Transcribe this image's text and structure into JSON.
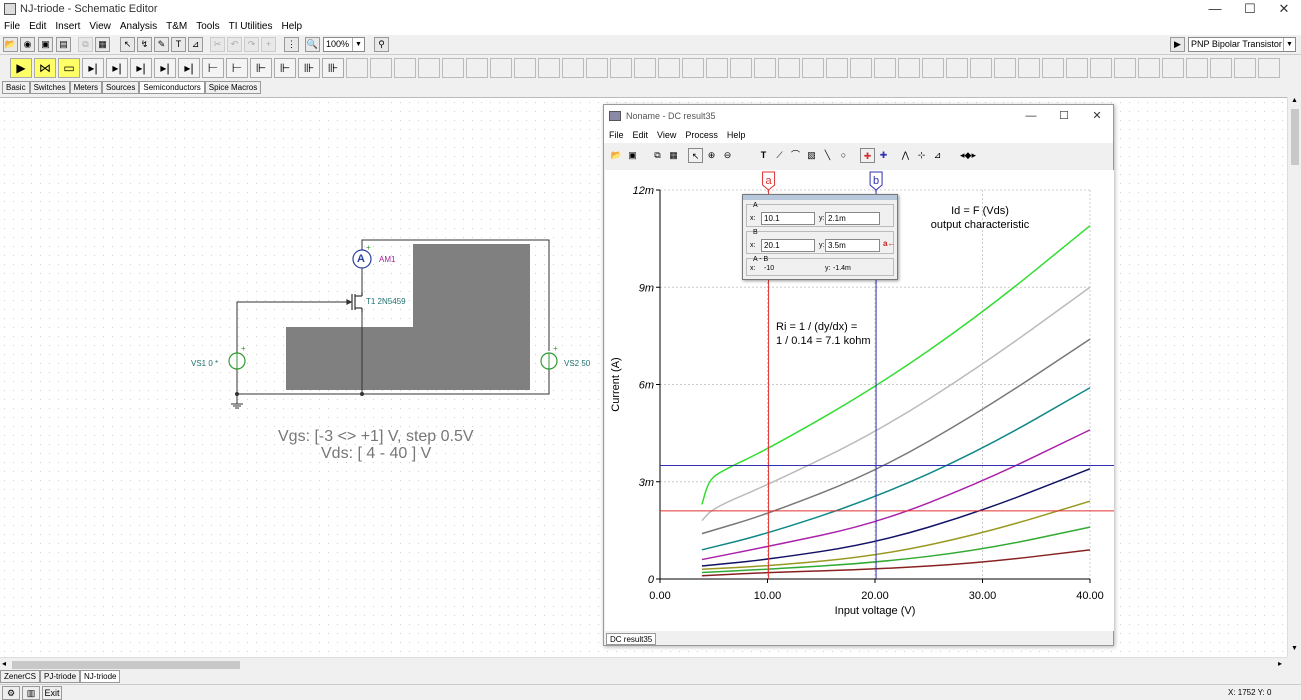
{
  "app": {
    "title": "NJ-triode - Schematic Editor",
    "window_controls": [
      "—",
      "☐",
      "✕"
    ]
  },
  "menu": [
    "File",
    "Edit",
    "Insert",
    "View",
    "Analysis",
    "T&M",
    "Tools",
    "TI Utilities",
    "Help"
  ],
  "toolbar": {
    "zoom_value": "100%",
    "component_select": "PNP Bipolar Transistor"
  },
  "component_tabs": [
    "Basic",
    "Switches",
    "Meters",
    "Sources",
    "Semiconductors",
    "Spice Macros"
  ],
  "component_tabs_selected": 4,
  "schematic": {
    "ammeter_label": "AM1",
    "ammeter_symbol": "A",
    "transistor_label": "T1 2N5459",
    "source1_label": "VS1 0 *",
    "source2_label": "VS2 50",
    "plus_sign": "+",
    "caption_line1": "Vgs: [-3 <> +1] V, step 0.5V",
    "caption_line2": "Vds: [ 4 - 40 ] V",
    "colors": {
      "wire": "#333333",
      "source": "#2e9a2e",
      "ammeter": "#2b3fa0",
      "grey_block": "#808080"
    }
  },
  "result_window": {
    "title": "Noname - DC result35",
    "menu": [
      "File",
      "Edit",
      "View",
      "Process",
      "Help"
    ],
    "tab": "DC result35"
  },
  "cursor_panel": {
    "group_a": "A",
    "group_b": "B",
    "group_diff": "A - B",
    "x_label": "x:",
    "y_label": "y:",
    "a_x": "10.1",
    "a_y": "2.1m",
    "b_x": "20.1",
    "b_y": "3.5m",
    "diff_x": "-10",
    "diff_y": "-1.4m",
    "marker_button": "a←"
  },
  "chart_data": {
    "type": "line",
    "title": "Id = F (Vds)",
    "subtitle": "output characteristic",
    "xlabel": "Input voltage (V)",
    "ylabel": "Current (A)",
    "xlim": [
      0,
      40
    ],
    "ylim": [
      0,
      0.012
    ],
    "x_ticks": [
      0,
      10,
      20,
      30,
      40
    ],
    "x_tick_labels": [
      "0.00",
      "10.00",
      "20.00",
      "30.00",
      "40.00"
    ],
    "y_ticks": [
      0,
      0.003,
      0.006,
      0.009,
      0.012
    ],
    "y_tick_labels": [
      "0",
      "3m",
      "6m",
      "9m",
      "12m"
    ],
    "grid": true,
    "annotation_line1": "Ri = 1 / (dy/dx) =",
    "annotation_line2": "1 / 0.14 = 7.1 kohm",
    "cursor_a": {
      "label": "a",
      "x": 10.1,
      "y": 0.0021,
      "color": "#e03030"
    },
    "cursor_b": {
      "label": "b",
      "x": 20.1,
      "y": 0.0035,
      "color": "#3030b0"
    },
    "series": [
      {
        "color": "#33dd33",
        "x": [
          3.9,
          4.5,
          5.5,
          10,
          20,
          30,
          40
        ],
        "values": [
          0.0023,
          0.003,
          0.0033,
          0.004,
          0.0059,
          0.0082,
          0.0109
        ]
      },
      {
        "color": "#bbbbbb",
        "x": [
          3.9,
          5,
          10,
          20,
          30,
          40
        ],
        "values": [
          0.0018,
          0.0022,
          0.0029,
          0.0045,
          0.0066,
          0.009
        ]
      },
      {
        "color": "#777777",
        "x": [
          3.9,
          10,
          20,
          30,
          40
        ],
        "values": [
          0.0014,
          0.002,
          0.0033,
          0.0052,
          0.0074
        ]
      },
      {
        "color": "#118888",
        "x": [
          3.9,
          10,
          20,
          30,
          40
        ],
        "values": [
          0.0009,
          0.0014,
          0.0025,
          0.004,
          0.0059
        ]
      },
      {
        "color": "#aa22aa",
        "x": [
          3.9,
          10,
          20,
          30,
          40
        ],
        "values": [
          0.0006,
          0.001,
          0.0017,
          0.003,
          0.0046
        ]
      },
      {
        "color": "#111166",
        "x": [
          3.9,
          10,
          20,
          30,
          40
        ],
        "values": [
          0.0004,
          0.0006,
          0.0011,
          0.0021,
          0.0034
        ]
      },
      {
        "color": "#999922",
        "x": [
          3.9,
          10,
          20,
          30,
          40
        ],
        "values": [
          0.0003,
          0.0004,
          0.0007,
          0.0014,
          0.0024
        ]
      },
      {
        "color": "#33aa33",
        "x": [
          3.9,
          10,
          20,
          30,
          40
        ],
        "values": [
          0.0002,
          0.0003,
          0.0005,
          0.0009,
          0.0016
        ]
      },
      {
        "color": "#882222",
        "x": [
          3.9,
          10,
          20,
          30,
          40
        ],
        "values": [
          0.0001,
          0.0002,
          0.0003,
          0.0005,
          0.0009
        ]
      }
    ]
  },
  "doc_tabs": [
    "ZenerCS",
    "PJ-triode",
    "NJ-triode"
  ],
  "doc_tabs_selected": 2,
  "status": {
    "exit_label": "Exit",
    "coords": "X: 1752 Y: 0"
  }
}
